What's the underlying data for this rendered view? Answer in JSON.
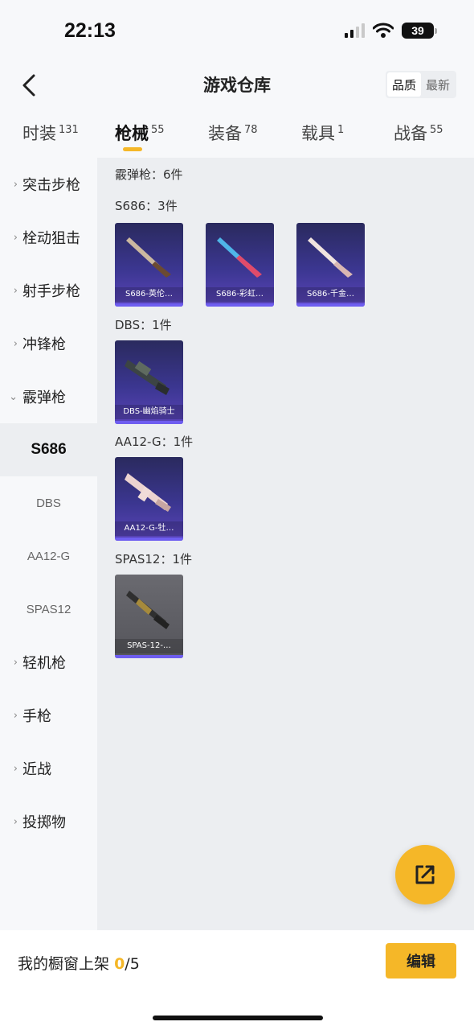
{
  "status_bar": {
    "time": "22:13",
    "battery": "39"
  },
  "header": {
    "title": "游戏仓库",
    "sort_options": [
      "品质",
      "最新"
    ],
    "active_sort": "品质"
  },
  "tabs": [
    {
      "label": "时装",
      "count": "131"
    },
    {
      "label": "枪械",
      "count": "55",
      "active": true
    },
    {
      "label": "装备",
      "count": "78"
    },
    {
      "label": "载具",
      "count": "1"
    },
    {
      "label": "战备",
      "count": "55"
    }
  ],
  "sidebar": {
    "categories": [
      "突击步枪",
      "栓动狙击",
      "射手步枪",
      "冲锋枪",
      "霰弹枪",
      "轻机枪",
      "手枪",
      "近战",
      "投掷物"
    ],
    "expanded_category": "霰弹枪",
    "subcategories": [
      "S686",
      "DBS",
      "AA12-G",
      "SPAS12"
    ],
    "selected_subcategory": "S686"
  },
  "content": {
    "summary": "霰弹枪：6件",
    "groups": [
      {
        "heading": "S686：3件",
        "items": [
          "S686-英伦…",
          "S686-彩虹…",
          "S686-千金…"
        ]
      },
      {
        "heading": "DBS：1件",
        "items": [
          "DBS-幽焰骑士"
        ]
      },
      {
        "heading": "AA12-G：1件",
        "items": [
          "AA12-G-牡…"
        ]
      },
      {
        "heading": "SPAS12：1件",
        "items": [
          "SPAS-12-…"
        ]
      }
    ]
  },
  "bottom_bar": {
    "label": "我的橱窗上架",
    "current": "0",
    "total": "/5",
    "edit_label": "编辑"
  },
  "colors": {
    "accent": "#f5b728",
    "card_purple": "#3b3690",
    "card_gray": "#5a5a60"
  },
  "icons": [
    "back-icon",
    "signal-icon",
    "wifi-icon",
    "battery-icon",
    "chevron-right-icon",
    "chevron-down-icon",
    "share-icon"
  ]
}
